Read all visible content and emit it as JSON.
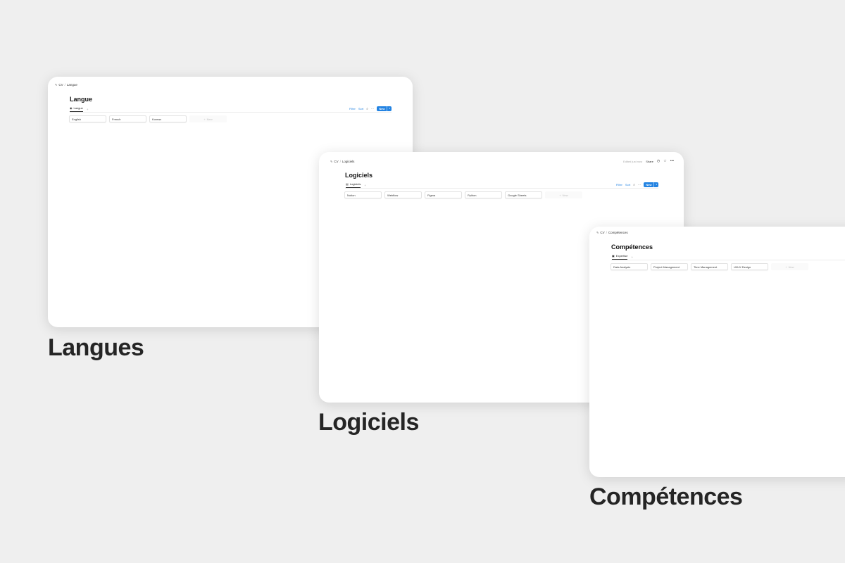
{
  "cards": {
    "langue": {
      "breadcrumb": [
        "CV",
        "Langue"
      ],
      "title": "Langue",
      "view_tab": "Langue",
      "toolbar": {
        "filter": "Filter",
        "sort": "Sort",
        "more": "···",
        "new": "New"
      },
      "columns": [
        "English",
        "French",
        "Korean"
      ],
      "new_column": "New"
    },
    "logiciels": {
      "breadcrumb": [
        "CV",
        "Logiciels"
      ],
      "topbar": {
        "edited": "Edited just now",
        "share": "Share"
      },
      "title": "Logiciels",
      "view_tab": "Logiciels",
      "toolbar": {
        "filter": "Filter",
        "sort": "Sort",
        "more": "···",
        "new": "New"
      },
      "columns": [
        "Notion",
        "Webflow",
        "Figma",
        "Python",
        "Google Sheets"
      ],
      "new_column": "New"
    },
    "competences": {
      "breadcrumb": [
        "CV",
        "Compétences"
      ],
      "title": "Compétences",
      "view_tab": "Expertise",
      "columns": [
        "Data Analysis",
        "Project Management",
        "Time Management",
        "UI/UX Design"
      ],
      "new_column": "New"
    }
  },
  "captions": {
    "langues": "Langues",
    "logiciels": "Logiciels",
    "competences": "Compétences"
  },
  "icons": {
    "page": "page-icon",
    "globe": "globe-icon",
    "table": "table-icon",
    "book": "book-icon",
    "search": "search-icon",
    "clock": "clock-icon",
    "star": "star-icon",
    "more": "more-icon",
    "plus": "plus-icon",
    "chevron": "chevron-down-icon"
  },
  "colors": {
    "background": "#efefef",
    "accent": "#2383e2"
  }
}
